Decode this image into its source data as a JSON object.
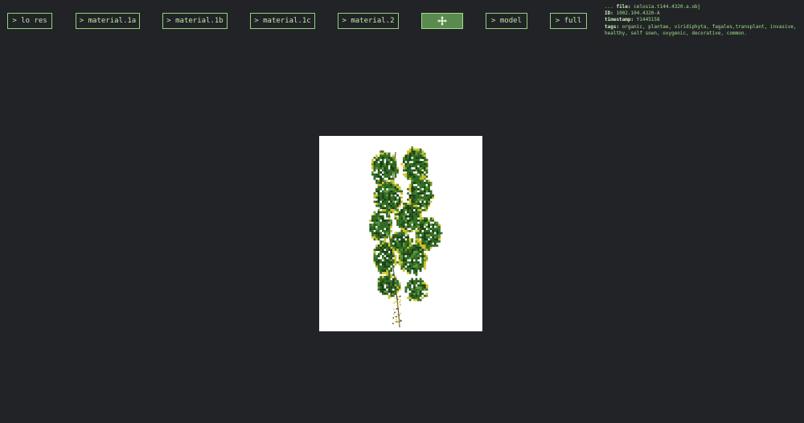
{
  "toolbar": {
    "buttons": [
      {
        "label": "> lo res"
      },
      {
        "label": "> material.1a"
      },
      {
        "label": "> material.1b"
      },
      {
        "label": "> material.1c"
      },
      {
        "label": "> material.2"
      },
      {
        "label": ""
      },
      {
        "label": "> model"
      },
      {
        "label": "> full"
      }
    ],
    "active_icon": "crosshair-move-icon"
  },
  "meta": {
    "file_prefix": "... ",
    "file_key": "file",
    "file_value": "celosia.t144.4320.a.obj",
    "id_key": "ID",
    "id_value": "1002.104.4320-A",
    "timestamp_key": "timestamp",
    "timestamp_value": "Y1445158",
    "tags_key": "tags",
    "tags_value": "organic, plantae, viridiphyta, fagales,transplant, invasive, healthy, self sown, oxygenic, decorative, common."
  },
  "viewer": {
    "background": "#ffffff",
    "leaf_color": "#2f6b22",
    "leaf_dark": "#1b3f14",
    "highlight": "#d8c227"
  },
  "colors": {
    "accent": "#8fd27e",
    "text": "#b8ecaa",
    "page_bg": "#222326"
  }
}
